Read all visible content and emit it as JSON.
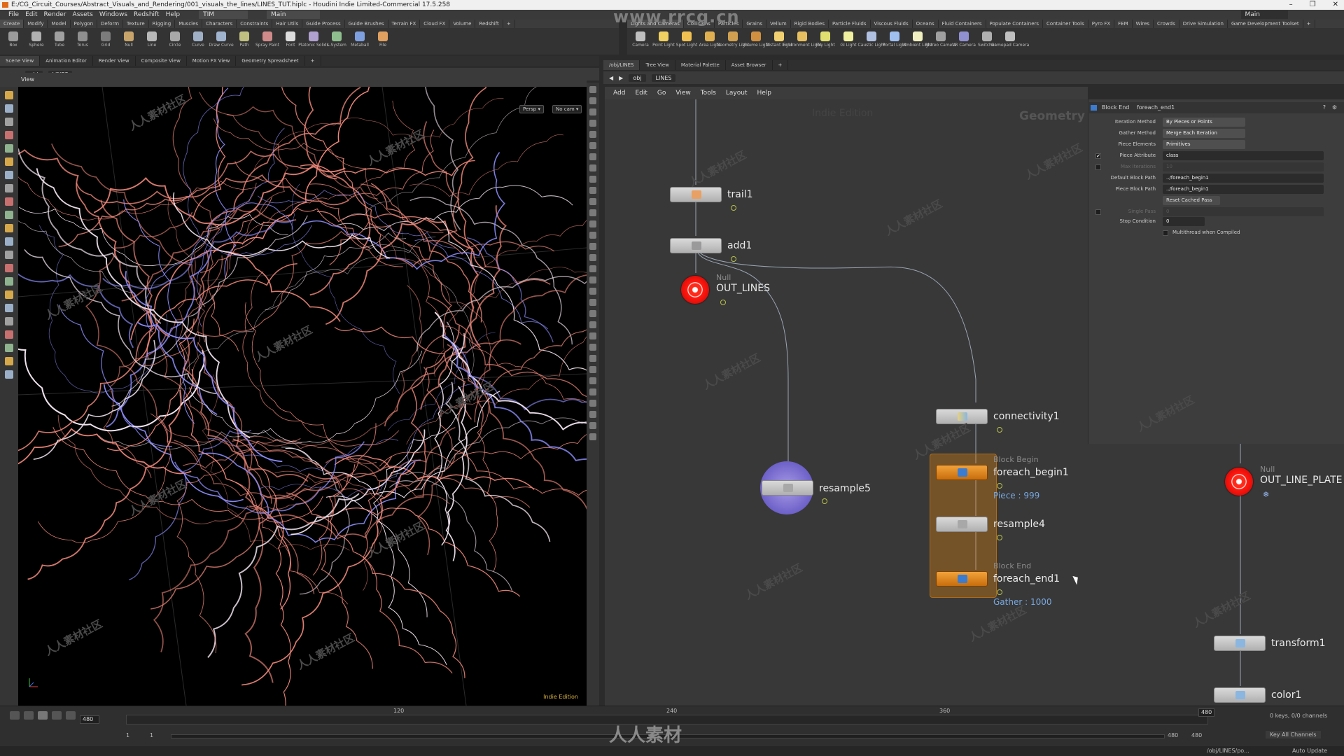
{
  "window": {
    "title": "E:/CG_Circuit_Courses/Abstract_Visuals_and_Rendering/001_visuals_the_lines/LINES_TUT.hiplc - Houdini Indie Limited-Commercial 17.5.258",
    "minimize": "–",
    "maximize": "❐",
    "close": "✕"
  },
  "menubar": {
    "items": [
      "File",
      "Edit",
      "Render",
      "Assets",
      "Windows",
      "Redshift",
      "Help"
    ],
    "desktop": "TIM",
    "desktop2": "Main",
    "right_desktop": "Main"
  },
  "shelf_left": {
    "tabs": [
      "Create",
      "Modify",
      "Model",
      "Polygon",
      "Deform",
      "Texture",
      "Rigging",
      "Muscles",
      "Characters",
      "Constraints",
      "Hair Utils",
      "Guide Process",
      "Guide Brushes",
      "Terrain FX",
      "Cloud FX",
      "Volume",
      "Redshift",
      "+"
    ],
    "tools": [
      "Box",
      "Sphere",
      "Tube",
      "Torus",
      "Grid",
      "Null",
      "Line",
      "Circle",
      "Curve",
      "Draw Curve",
      "Path",
      "Spray Paint",
      "Font",
      "Platonic Solids",
      "L-System",
      "Metaball",
      "File"
    ]
  },
  "shelf_right": {
    "tabs": [
      "Lights and Cameras",
      "Collisions",
      "Particles",
      "Grains",
      "Vellum",
      "Rigid Bodies",
      "Particle Fluids",
      "Viscous Fluids",
      "Oceans",
      "Fluid Containers",
      "Populate Containers",
      "Container Tools",
      "Pyro FX",
      "FEM",
      "Wires",
      "Crowds",
      "Drive Simulation",
      "Game Development Toolset",
      "+"
    ],
    "tools": [
      "Camera",
      "Point Light",
      "Spot Light",
      "Area Light",
      "Geometry Light",
      "Volume Light",
      "Distant Light",
      "Environment Light",
      "Sky Light",
      "GI Light",
      "Caustic Light",
      "Portal Light",
      "Ambient Light",
      "Stereo Camera",
      "VR Camera",
      "Switcher",
      "Gamepad Camera"
    ]
  },
  "left_pane": {
    "tabs": [
      "Scene View",
      "Animation Editor",
      "Render View",
      "Composite View",
      "Motion FX View",
      "Geometry Spreadsheet",
      "+"
    ],
    "path_root": "obj",
    "path_node": "LINES",
    "viewport_label": "View",
    "persp_btn": "Persp ▾",
    "cam_btn": "No cam ▾",
    "edition": "Indie Edition"
  },
  "right_pane": {
    "tabs": [
      "/obj/LINES",
      "Tree View",
      "Material Palette",
      "Asset Browser",
      "+"
    ],
    "path_root": "obj",
    "path_node": "LINES",
    "menu": [
      "Add",
      "Edit",
      "Go",
      "View",
      "Tools",
      "Layout",
      "Help"
    ],
    "edition": "Indie Edition",
    "context": "Geometry"
  },
  "nodes": {
    "trail1": "trail1",
    "add1": "add1",
    "out_lines_type": "Null",
    "out_lines": "OUT_LINES",
    "connectivity1": "connectivity1",
    "resample5": "resample5",
    "foreach_begin1_type": "Block Begin",
    "foreach_begin1": "foreach_begin1",
    "foreach_begin1_info": "Piece : 999",
    "resample4": "resample4",
    "foreach_end1_type": "Block End",
    "foreach_end1": "foreach_end1",
    "foreach_end1_info": "Gather : 1000",
    "out_line_plate_type": "Null",
    "out_line_plate": "OUT_LINE_PLATE",
    "transform1": "transform1",
    "color1": "color1"
  },
  "params": {
    "node_type": "Block End",
    "node_name": "foreach_end1",
    "rows": [
      {
        "label": "Iteration Method",
        "value": "By Pieces or Points",
        "kind": "menu"
      },
      {
        "label": "Gather Method",
        "value": "Merge Each Iteration",
        "kind": "menu"
      },
      {
        "label": "Piece Elements",
        "value": "Primitives",
        "kind": "menu"
      },
      {
        "label": "Piece Attribute",
        "value": "class",
        "kind": "text",
        "checked": "✔"
      },
      {
        "label": "Max Iterations",
        "value": "10",
        "kind": "dim"
      },
      {
        "label": "Default Block Path",
        "value": "../foreach_begin1",
        "kind": "text"
      },
      {
        "label": "Piece Block Path",
        "value": "../foreach_begin1",
        "kind": "text"
      },
      {
        "label": "",
        "value": "Reset Cached Pass",
        "kind": "button"
      },
      {
        "label": "Single Pass",
        "value": "0",
        "kind": "dim"
      },
      {
        "label": "Stop Condition",
        "value": "0",
        "kind": "text"
      },
      {
        "label": "",
        "value": "Multithread when Compiled",
        "kind": "check"
      }
    ]
  },
  "timeline": {
    "current_frame": "480",
    "ticks": [
      "120",
      "240",
      "360"
    ],
    "end_marker": "480",
    "start": "1",
    "start2": "1",
    "range_end": "480",
    "range_end2": "480",
    "keys": "0 keys, 0/0 channels",
    "key_all": "Key All Channels",
    "auto_update": "Auto Update",
    "status_path": "/obj/LINES/po..."
  },
  "watermarks": {
    "top": "www.rrcg.cn",
    "bottom": "人人素材",
    "tile": "人人素材社区"
  },
  "colors": {
    "accent_orange": "#e8860f",
    "null_red": "#ff1a10",
    "info_blue": "#78a8e0",
    "curve_pink": "#f0887a",
    "curve_white": "#f3e6f0",
    "curve_blue": "#8f90ff"
  }
}
